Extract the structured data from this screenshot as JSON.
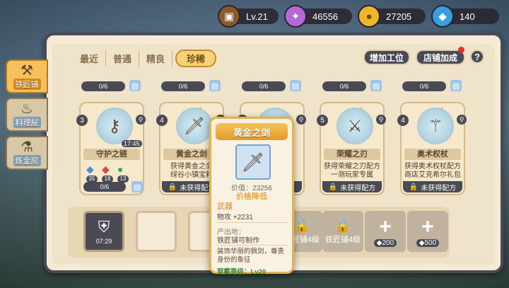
{
  "status_bar": {
    "level": "Lv.21",
    "gems": "46556",
    "gold": "27205",
    "diamonds": "140"
  },
  "side_tabs": [
    {
      "label": "铁匠铺",
      "icon": "anvil-icon",
      "active": true
    },
    {
      "label": "料理屋",
      "icon": "pot-icon",
      "active": false
    },
    {
      "label": "炼金房",
      "icon": "flask-icon",
      "active": false
    }
  ],
  "filter_tabs": [
    {
      "label": "最近",
      "active": false
    },
    {
      "label": "普通",
      "active": false
    },
    {
      "label": "精良",
      "active": false
    },
    {
      "label": "珍稀",
      "active": true
    }
  ],
  "toolbar": {
    "add_station": "增加工位",
    "shop_bonus": "店铺加成",
    "help": "?"
  },
  "top_strips": [
    {
      "progress": "0/6"
    },
    {
      "progress": "0/6"
    },
    {
      "progress": "0/6"
    },
    {
      "progress": "0/6"
    },
    {
      "progress": "0/6"
    }
  ],
  "cards": [
    {
      "level": "3",
      "name": "守护之链",
      "timer": "17:45",
      "mats": [
        {
          "icon": "blue-crystal",
          "n": "35"
        },
        {
          "icon": "red-crystal",
          "n": "18"
        },
        {
          "icon": "green-gem",
          "n": "13"
        }
      ],
      "progress": "0/6"
    },
    {
      "level": "4",
      "name": "黄金之剑",
      "desc": "获得黄金之剑\n绿谷小镇宝箱",
      "lock": "未获得配方"
    },
    {
      "level": "4",
      "name": "",
      "desc": "",
      "lock": ""
    },
    {
      "level": "5",
      "name": "荣耀之刃",
      "desc": "获得荣耀之刃配方\n一测玩家专属",
      "lock": "未获得配方"
    },
    {
      "level": "4",
      "name": "奥术权杖",
      "desc": "获得奥术权杖配方\n商店艾克希尔礼包",
      "lock": "未获得配方"
    }
  ],
  "slots": [
    {
      "type": "filled",
      "time": "07:29"
    },
    {
      "type": "empty"
    },
    {
      "type": "empty"
    },
    {
      "type": "locked",
      "label": "铁匠铺4级"
    },
    {
      "type": "locked",
      "label": "铁匠铺4级"
    },
    {
      "type": "plus",
      "price": "200"
    },
    {
      "type": "plus",
      "price": "500"
    }
  ],
  "tooltip": {
    "title": "黄金之剑",
    "price": "价值：23256",
    "price_tag": "价格降低",
    "type": "武器",
    "stat": "物攻 +2231",
    "origin_label": "产出地：",
    "origin": "铁匠铺可制作",
    "desc": "装饰华丽的佩剑，尊贵身份的象征",
    "requirement": "穿戴等级：Lv20"
  }
}
